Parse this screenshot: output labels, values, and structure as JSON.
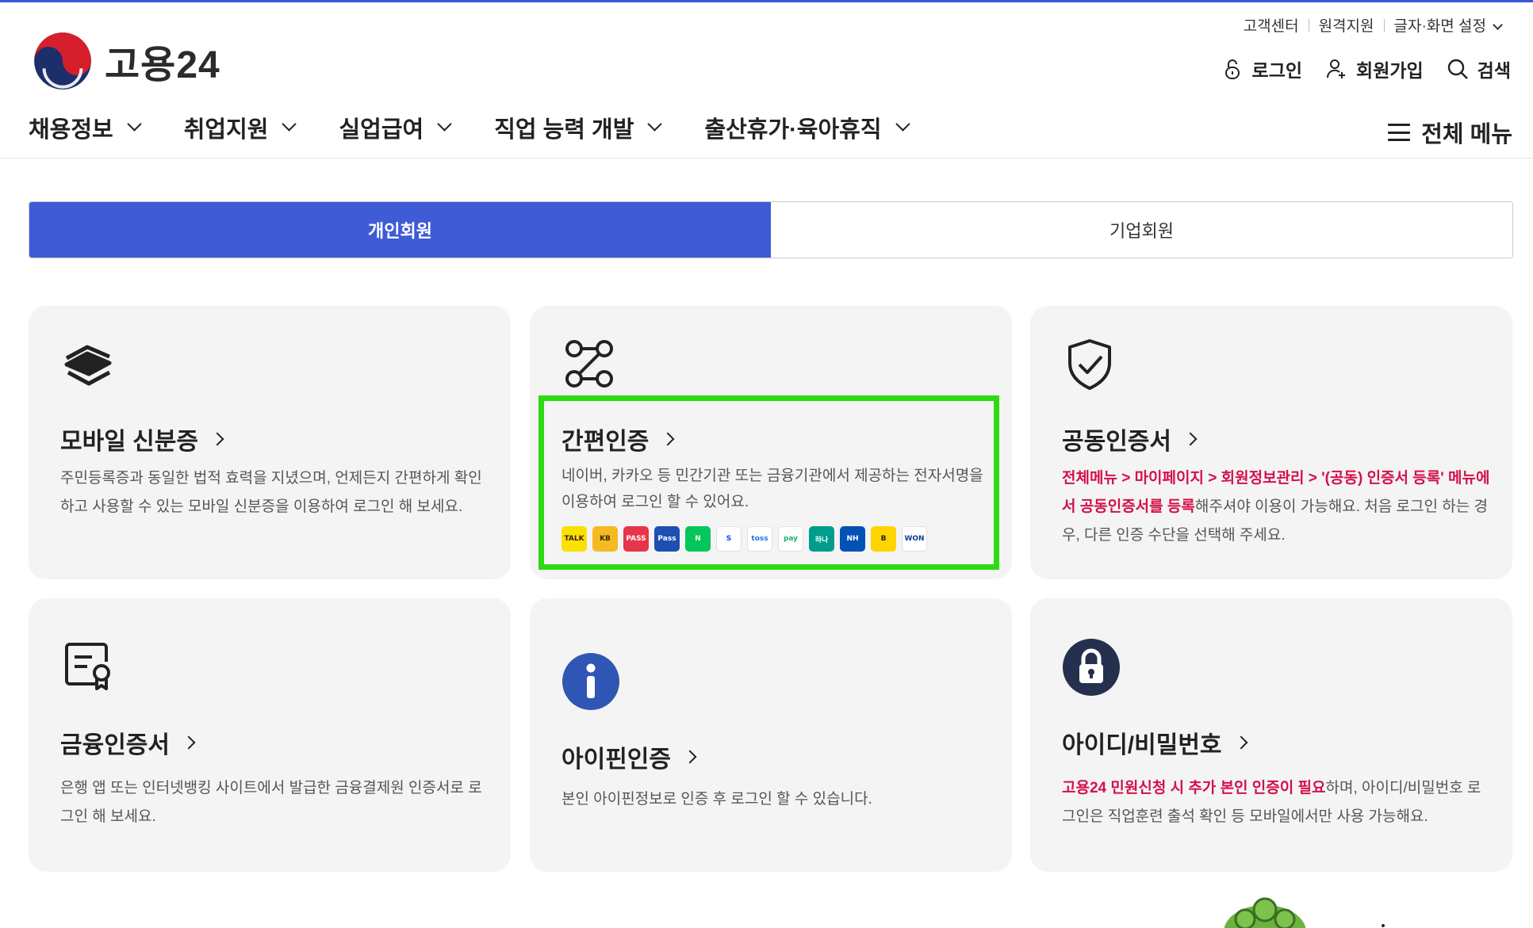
{
  "site": {
    "logo_text": "고용24"
  },
  "util_links": [
    "고객센터",
    "원격지원",
    "글자·화면 설정"
  ],
  "account": {
    "login": "로그인",
    "signup": "회원가입",
    "search": "검색"
  },
  "gnb": [
    "채용정보",
    "취업지원",
    "실업급여",
    "직업 능력 개발",
    "출산휴가·육아휴직"
  ],
  "all_menu": "전체 메뉴",
  "tabs": {
    "personal": "개인회원",
    "corporate": "기업회원",
    "active": "개인회원"
  },
  "cards": {
    "mobile_id": {
      "title": "모바일 신분증",
      "desc": "주민등록증과 동일한 법적 효력을 지녔으며, 언제든지 간편하게 확인하고 사용할 수 있는 모바일 신분증을 이용하여 로그인 해 보세요."
    },
    "simple_auth": {
      "title": "간편인증",
      "desc": "네이버, 카카오 등 민간기관 또는 금융기관에서 제공하는 전자서명을 이용하여 로그인 할 수 있어요.",
      "providers": [
        {
          "label": "TALK",
          "color": "#fae100",
          "fg": "#3a1d1d"
        },
        {
          "label": "KB",
          "color": "#f5b921",
          "fg": "#3a2b00"
        },
        {
          "label": "PASS",
          "color": "#e8354a",
          "fg": "#ffffff"
        },
        {
          "label": "Pass",
          "color": "#1e4fb3",
          "fg": "#ffffff"
        },
        {
          "label": "N",
          "color": "#03c75a",
          "fg": "#ffffff"
        },
        {
          "label": "S",
          "color": "#ffffff",
          "fg": "#0046ff"
        },
        {
          "label": "toss",
          "color": "#ffffff",
          "fg": "#1a73e8"
        },
        {
          "label": "pay",
          "color": "#ffffff",
          "fg": "#23b26d"
        },
        {
          "label": "하나",
          "color": "#009c8c",
          "fg": "#ffffff"
        },
        {
          "label": "NH",
          "color": "#0052b4",
          "fg": "#ffffff"
        },
        {
          "label": "B",
          "color": "#ffd400",
          "fg": "#222222"
        },
        {
          "label": "WON",
          "color": "#ffffff",
          "fg": "#0a3d91"
        }
      ]
    },
    "joint_cert": {
      "title": "공동인증서",
      "desc_highlight": "전체메뉴 > 마이페이지 > 회원정보관리 > '(공동) 인증서 등록' 메뉴에서 공동인증서를 등록",
      "desc_rest": "해주셔야 이용이 가능해요. 처음 로그인 하는 경우, 다른 인증 수단을 선택해 주세요."
    },
    "financial_cert": {
      "title": "금융인증서",
      "desc": "은행 앱 또는 인터넷뱅킹 사이트에서 발급한 금융결제원 인증서로 로그인 해 보세요."
    },
    "ipin": {
      "title": "아이핀인증",
      "desc": "본인 아이핀정보로 인증 후 로그인 할 수 있습니다."
    },
    "id_pw": {
      "title": "아이디/비밀번호",
      "desc_highlight": "고용24 민원신청 시 추가 본인 인증이 필요",
      "desc_rest": "하며, 아이디/비밀번호 로그인은 직업훈련 출석 확인 등 모바일에서만 사용 가능해요."
    }
  },
  "colors": {
    "accent": "#3f5bd6",
    "highlight_text": "#d3104a",
    "selection_box": "#2ddb12",
    "card_bg": "#f4f4f4"
  }
}
